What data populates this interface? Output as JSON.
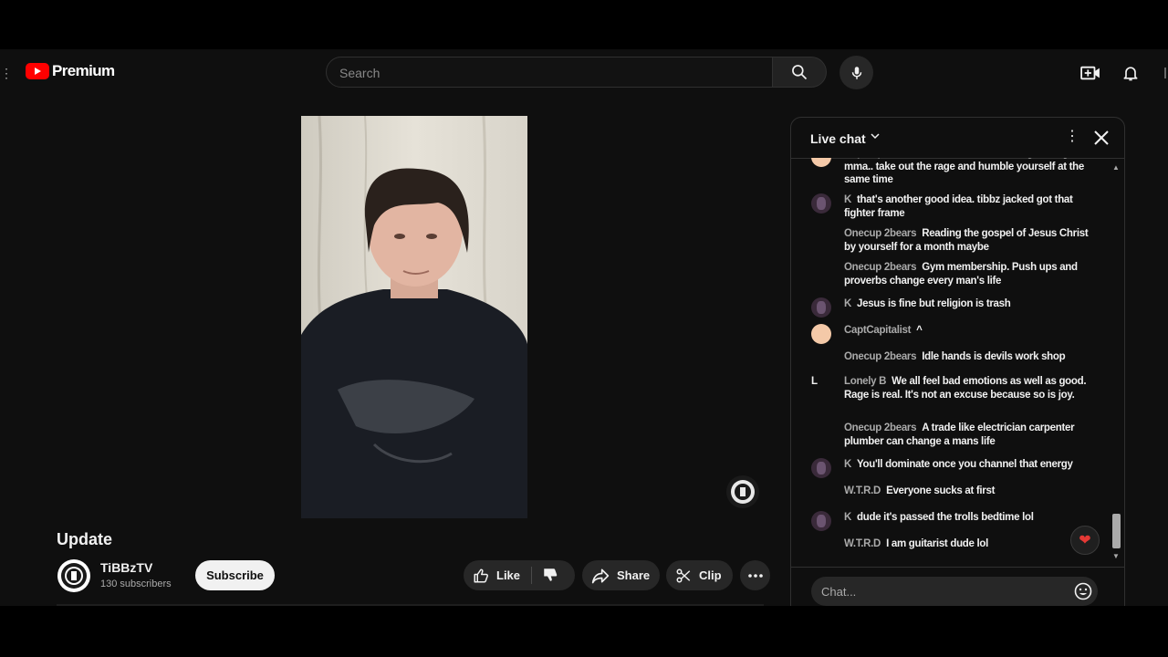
{
  "header": {
    "logo_text": "Premium",
    "search_placeholder": "Search"
  },
  "video": {
    "title": "Update",
    "channel_name": "TiBBzTV",
    "subscribers": "130 subscribers",
    "subscribe_label": "Subscribe",
    "like_label": "Like",
    "share_label": "Share",
    "clip_label": "Clip"
  },
  "chat": {
    "title": "Live chat",
    "input_placeholder": "Chat...",
    "messages": [
      {
        "author": "Captcapitalist",
        "avatar": "capt",
        "text": "He could also start doing boxing or mma.. take out the rage and humble yourself at the same time"
      },
      {
        "author": "K",
        "avatar": "k",
        "text": "that's another good idea. tibbz jacked got that fighter frame"
      },
      {
        "author": "Onecup 2bears",
        "avatar": "onecup",
        "text": "Reading the gospel of Jesus Christ by yourself for a month maybe"
      },
      {
        "author": "Onecup 2bears",
        "avatar": "onecup",
        "text": "Gym membership. Push ups and proverbs change every man's life"
      },
      {
        "author": "K",
        "avatar": "k",
        "text": "Jesus is fine but religion is trash"
      },
      {
        "author": "CaptCapitalist",
        "avatar": "capt",
        "text": "^"
      },
      {
        "author": "Onecup 2bears",
        "avatar": "onecup",
        "text": "Idle hands is devils work shop"
      },
      {
        "author": "Lonely B",
        "avatar": "lonely",
        "avatar_letter": "L",
        "text": "We all feel bad emotions as well as good. Rage is real. It's not an excuse because so is joy."
      },
      {
        "author": "Onecup 2bears",
        "avatar": "onecup",
        "text": "A trade like electrician carpenter plumber can change a mans life"
      },
      {
        "author": "K",
        "avatar": "k",
        "text": "You'll dominate once you channel that energy"
      },
      {
        "author": "W.T.R.D",
        "avatar": "wtrd",
        "text": "Everyone sucks at first"
      },
      {
        "author": "K",
        "avatar": "k",
        "text": "dude it's passed the trolls bedtime lol"
      },
      {
        "author": "W.T.R.D",
        "avatar": "wtrd",
        "text": "I am guitarist dude lol"
      }
    ]
  },
  "icons": {
    "logo": "youtube-logo-icon",
    "search": "search-icon",
    "mic": "microphone-icon",
    "create": "create-video-icon",
    "notifications": "bell-icon",
    "like": "thumbs-up-icon",
    "dislike": "thumbs-down-icon",
    "share": "share-arrow-icon",
    "clip": "scissors-icon",
    "more": "more-horizontal-icon",
    "chat_menu": "kebab-menu-icon",
    "chat_close": "close-icon",
    "emoji": "emoji-icon",
    "reaction": "heart-icon"
  },
  "colors": {
    "page_bg": "#0f0f0f",
    "brand_red": "#ff0000",
    "pill_bg": "#272727",
    "subscribe_bg": "#f1f1f1",
    "heart": "#e53935"
  }
}
